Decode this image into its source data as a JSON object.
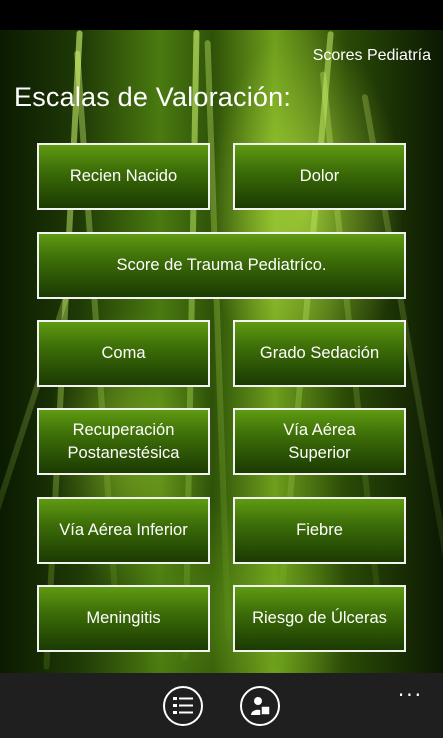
{
  "app_title": "Scores Pediatría",
  "page_title": "Escalas de Valoración:",
  "buttons": {
    "recien_nacido": "Recien Nacido",
    "dolor": "Dolor",
    "trauma": "Score de Trauma Pediatríco.",
    "coma": "Coma",
    "sedacion": "Grado Sedación",
    "recuperacion_l1": "Recuperación",
    "recuperacion_l2": "Postanestésica",
    "via_superior_l1": "Vía Aérea",
    "via_superior_l2": "Superior",
    "via_inferior": "Vía Aérea Inferior",
    "fiebre": "Fiebre",
    "meningitis": "Meningitis",
    "ulceras": "Riesgo de Úlceras"
  },
  "app_bar": {
    "icons": [
      "checklist-icon",
      "user-card-icon"
    ],
    "more": "..."
  }
}
